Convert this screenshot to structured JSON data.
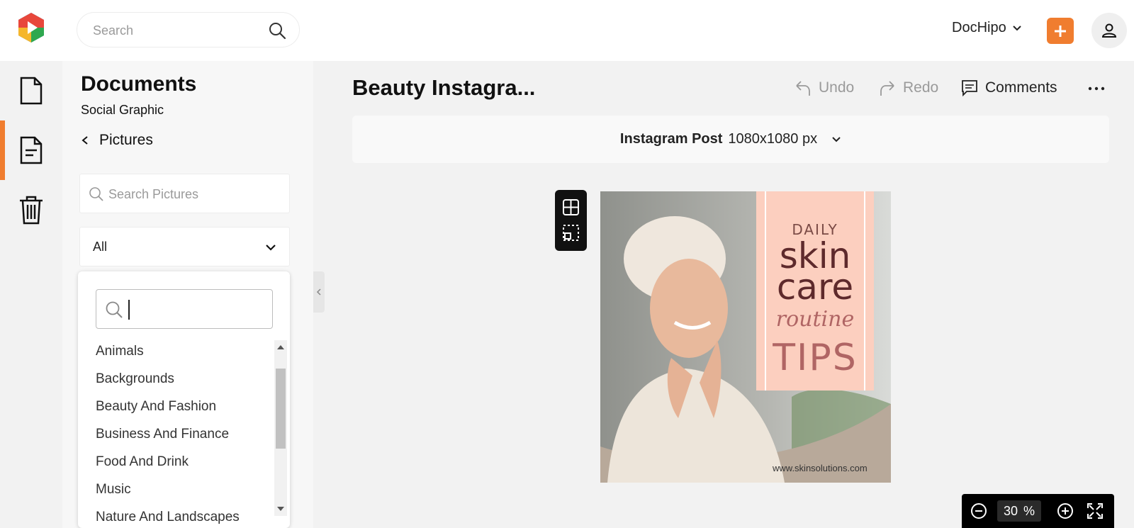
{
  "header": {
    "search_placeholder": "Search",
    "workspace_name": "DocHipo"
  },
  "sidebar_panel": {
    "title": "Documents",
    "subtitle": "Social Graphic",
    "back_label": "Pictures",
    "picture_search_placeholder": "Search Pictures",
    "category_selected": "All",
    "category_options": [
      "Animals",
      "Backgrounds",
      "Beauty And Fashion",
      "Business And Finance",
      "Food And Drink",
      "Music",
      "Nature And Landscapes"
    ]
  },
  "editor": {
    "doc_title": "Beauty Instagra...",
    "undo_label": "Undo",
    "redo_label": "Redo",
    "comments_label": "Comments",
    "size_name": "Instagram Post",
    "size_dims": "1080x1080 px"
  },
  "design": {
    "line1": "DAILY",
    "line2": "skin",
    "line3": "care",
    "line4": "routine",
    "line5": "TIPS",
    "url": "www.skinsolutions.com"
  },
  "zoom": {
    "value": "30",
    "unit": "%"
  },
  "colors": {
    "accent": "#f07d2f",
    "panel_pink": "#fccfbf"
  }
}
